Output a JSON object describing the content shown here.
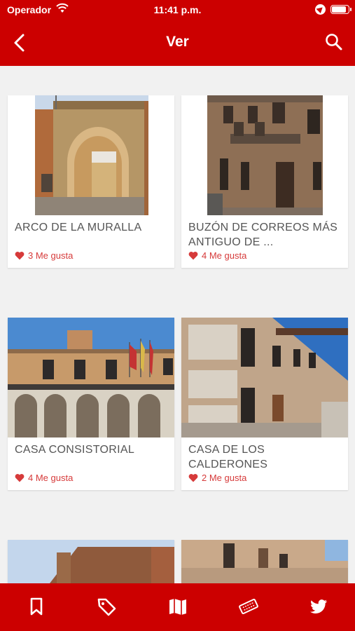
{
  "status": {
    "carrier": "Operador",
    "time": "11:41 p.m."
  },
  "header": {
    "title": "Ver"
  },
  "cards": [
    {
      "title": "ARCO DE LA MURALLA",
      "likes": "3 Me gusta"
    },
    {
      "title": "BUZÓN DE CORREOS MÁS ANTIGUO DE ...",
      "likes": "4 Me gusta"
    },
    {
      "title": "CASA CONSISTORIAL",
      "likes": "4 Me gusta"
    },
    {
      "title": "CASA DE LOS CALDERONES",
      "likes": "2 Me gusta"
    }
  ],
  "tabbar": {
    "icons": [
      "bookmark-icon",
      "tag-icon",
      "map-icon",
      "ticket-icon",
      "twitter-icon"
    ]
  },
  "colors": {
    "brand": "#cc0000",
    "like": "#d63a3a",
    "background": "#f1f1f1"
  }
}
